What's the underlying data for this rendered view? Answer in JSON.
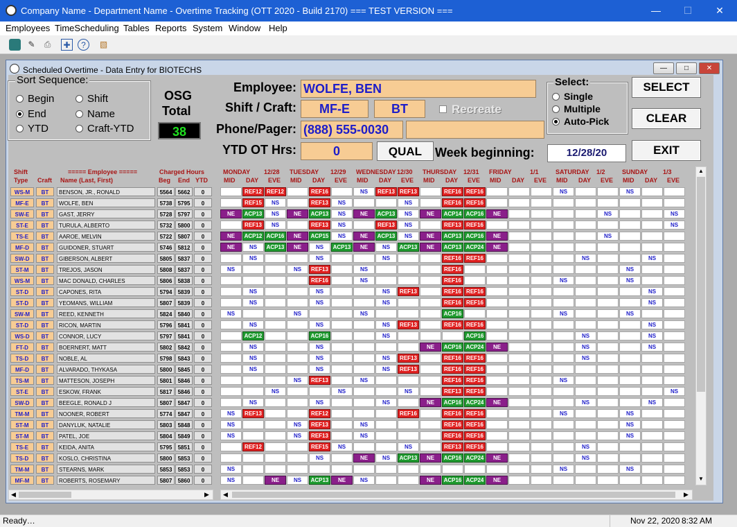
{
  "app": {
    "title": "Company Name - Department Name - Overtime Tracking (OTT 2020 - Build 2170)  === TEST VERSION ==="
  },
  "menu": [
    "Employees",
    "TimeScheduling",
    "Tables",
    "Reports",
    "System",
    "Window",
    "Help"
  ],
  "window": {
    "title": "Scheduled Overtime - Data Entry for BIOTECHS"
  },
  "sort": {
    "legend": "Sort Sequence:",
    "options": [
      "Begin",
      "End",
      "YTD",
      "Shift",
      "Name",
      "Craft-YTD"
    ],
    "selected": "End"
  },
  "osg": {
    "label1": "OSG",
    "label2": "Total",
    "value": "38"
  },
  "employee": {
    "label": "Employee:",
    "value": "WOLFE, BEN"
  },
  "shift": {
    "label": "Shift / Craft:",
    "shift": "MF-E",
    "craft": "BT",
    "recreate": "Recreate"
  },
  "phone": {
    "label": "Phone/Pager:",
    "value": "(888) 555-0030",
    "pager": ""
  },
  "ytd": {
    "label": "YTD OT Hrs:",
    "value": "0",
    "qual": "QUAL"
  },
  "week": {
    "label": "Week beginning:",
    "value": "12/28/20"
  },
  "select": {
    "legend": "Select:",
    "options": [
      "Single",
      "Multiple",
      "Auto-Pick"
    ],
    "selected": "Auto-Pick"
  },
  "buttons": {
    "select": "SELECT",
    "clear": "CLEAR",
    "exit": "EXIT"
  },
  "grid_headers": {
    "shift_type": "Shift\nType",
    "craft": "Craft",
    "employee": "===== Employee =====",
    "name": "Name (Last, First)",
    "charged": "Charged Hours",
    "beg": "Beg",
    "end": "End",
    "ytd": "YTD"
  },
  "days": [
    {
      "name": "MONDAY",
      "date": "12/28"
    },
    {
      "name": "TUESDAY",
      "date": "12/29"
    },
    {
      "name": "WEDNESDAY",
      "date": "12/30"
    },
    {
      "name": "THURSDAY",
      "date": "12/31"
    },
    {
      "name": "FRIDAY",
      "date": "1/1"
    },
    {
      "name": "SATURDAY",
      "date": "1/2"
    },
    {
      "name": "SUNDAY",
      "date": "1/3"
    }
  ],
  "sub": [
    "MID",
    "DAY",
    "EVE"
  ],
  "rows": [
    {
      "t": "WS-M",
      "c": "BT",
      "n": "BENSON, JR., RONALD",
      "b": "5564",
      "e": "5662",
      "y": "0",
      "s": "0 REF12 REF12 0 REF16 0 NS REF13 REF13 0 REF16 REF16 0 0 0 NS 0 0 NS 0 0"
    },
    {
      "t": "MF-E",
      "c": "BT",
      "n": "WOLFE, BEN",
      "b": "5738",
      "e": "5795",
      "y": "0",
      "s": "0 REF15 NS 0 REF13 NS 0 0 NS 0 REF16 REF16 0 0 0 0 0 0 0 0 0"
    },
    {
      "t": "SW-E",
      "c": "BT",
      "n": "GAST, JERRY",
      "b": "5728",
      "e": "5797",
      "y": "0",
      "s": "NE ACP13 NS NE ACP13 NS NE ACP13 NS NE ACP14 ACP16 NE 0 0 0 0 NS 0 0 NS"
    },
    {
      "t": "ST-E",
      "c": "BT",
      "n": "TURULA, ALBERTO",
      "b": "5732",
      "e": "5800",
      "y": "0",
      "s": "0 REF13 NS 0 REF13 NS 0 REF13 NS 0 REF13 REF16 0 0 0 0 0 0 0 0 NS"
    },
    {
      "t": "TS-E",
      "c": "BT",
      "n": "AAROE, MELVIN",
      "b": "5722",
      "e": "5807",
      "y": "0",
      "s": "NE ACP12 ACP16 NE ACP15 NS NE ACP13 NS NE ACP13 ACP16 NE 0 0 0 0 NS 0 0 0"
    },
    {
      "t": "MF-D",
      "c": "BT",
      "n": "GUIDONER, STUART",
      "b": "5746",
      "e": "5812",
      "y": "0",
      "s": "NE NS ACP13 NE NS ACP13 NE NS ACP13 NE ACP13 ACP24 NE 0 0 0 0 0 0 0 0"
    },
    {
      "t": "SW-D",
      "c": "BT",
      "n": "GIBERSON, ALBERT",
      "b": "5805",
      "e": "5837",
      "y": "0",
      "s": "0 NS 0 0 NS 0 0 NS 0 0 REF16 REF16 0 0 0 0 NS 0 0 NS 0"
    },
    {
      "t": "ST-M",
      "c": "BT",
      "n": "TREJOS, JASON",
      "b": "5808",
      "e": "5837",
      "y": "0",
      "s": "NS 0 0 NS REF13 0 NS 0 0 0 REF16 0 0 0 0 0 0 0 NS 0 0"
    },
    {
      "t": "WS-M",
      "c": "BT",
      "n": "MAC DONALD, CHARLES",
      "b": "5806",
      "e": "5838",
      "y": "0",
      "s": "0 0 0 0 REF16 0 NS 0 0 0 REF16 0 0 0 0 NS 0 0 NS 0 0"
    },
    {
      "t": "ST-D",
      "c": "BT",
      "n": "CAPONES, RITA",
      "b": "5794",
      "e": "5839",
      "y": "0",
      "s": "0 NS 0 0 NS 0 0 NS REF13 0 REF16 REF16 0 0 0 0 0 0 0 NS 0"
    },
    {
      "t": "ST-D",
      "c": "BT",
      "n": "YEOMANS, WILLIAM",
      "b": "5807",
      "e": "5839",
      "y": "0",
      "s": "0 NS 0 0 NS 0 0 NS 0 0 REF16 REF16 0 0 0 0 0 0 0 NS 0"
    },
    {
      "t": "SW-M",
      "c": "BT",
      "n": "REED, KENNETH",
      "b": "5824",
      "e": "5840",
      "y": "0",
      "s": "NS 0 0 NS 0 0 NS 0 0 0 ACP16 0 0 0 0 NS 0 0 NS 0 0"
    },
    {
      "t": "ST-D",
      "c": "BT",
      "n": "RICON, MARTIN",
      "b": "5796",
      "e": "5841",
      "y": "0",
      "s": "0 NS 0 0 NS 0 0 NS REF13 0 REF16 REF16 0 0 0 0 0 0 0 NS 0"
    },
    {
      "t": "WS-D",
      "c": "BT",
      "n": "CONNOR, LUCY",
      "b": "5797",
      "e": "5841",
      "y": "0",
      "s": "0 ACP12 0 0 ACP16 0 0 NS 0 0 0 ACP16 0 0 0 0 NS 0 0 NS 0"
    },
    {
      "t": "FT-D",
      "c": "BT",
      "n": "BOERNERT, MATT",
      "b": "5802",
      "e": "5842",
      "y": "0",
      "s": "0 NS 0 0 NS 0 0 0 0 NE ACP16 ACP24 NE 0 0 0 NS 0 0 NS 0"
    },
    {
      "t": "TS-D",
      "c": "BT",
      "n": "NOBLE, AL",
      "b": "5798",
      "e": "5843",
      "y": "0",
      "s": "0 NS 0 0 NS 0 0 NS REF13 0 REF16 REF16 0 0 0 0 NS 0 0 0 0"
    },
    {
      "t": "MF-D",
      "c": "BT",
      "n": "ALVARADO, THYKASA",
      "b": "5800",
      "e": "5845",
      "y": "0",
      "s": "0 NS 0 0 NS 0 0 NS REF13 0 REF16 REF16 0 0 0 0 0 0 0 0 0"
    },
    {
      "t": "TS-M",
      "c": "BT",
      "n": "MATTESON, JOSEPH",
      "b": "5801",
      "e": "5846",
      "y": "0",
      "s": "0 0 0 NS REF13 0 NS 0 0 0 REF16 REF16 0 0 0 NS 0 0 0 0 0"
    },
    {
      "t": "ST-E",
      "c": "BT",
      "n": "ESKOW, FRANK",
      "b": "5817",
      "e": "5846",
      "y": "0",
      "s": "0 0 NS 0 0 NS 0 0 NS 0 REF13 REF16 0 0 0 0 0 0 0 0 NS"
    },
    {
      "t": "SW-D",
      "c": "BT",
      "n": "BEEGLE, RONALD J",
      "b": "5807",
      "e": "5847",
      "y": "0",
      "s": "0 NS 0 0 NS 0 0 NS 0 NE ACP16 ACP24 NE 0 0 0 NS 0 0 NS 0"
    },
    {
      "t": "TM-M",
      "c": "BT",
      "n": "NOONER, ROBERT",
      "b": "5774",
      "e": "5847",
      "y": "0",
      "s": "NS REF13 0 0 REF12 0 0 0 REF16 0 REF16 REF16 0 0 0 NS 0 0 NS 0 0"
    },
    {
      "t": "ST-M",
      "c": "BT",
      "n": "DANYLUK, NATALIE",
      "b": "5803",
      "e": "5848",
      "y": "0",
      "s": "NS 0 0 NS REF13 0 NS 0 0 0 REF16 REF16 0 0 0 0 0 0 NS 0 0"
    },
    {
      "t": "ST-M",
      "c": "BT",
      "n": "PATEL, JOE",
      "b": "5804",
      "e": "5849",
      "y": "0",
      "s": "NS 0 0 NS REF13 0 NS 0 0 0 REF16 REF16 0 0 0 0 0 0 NS 0 0"
    },
    {
      "t": "TS-E",
      "c": "BT",
      "n": "KEIDA, ANITA",
      "b": "5795",
      "e": "5851",
      "y": "0",
      "s": "0 REF12 0 0 REF15 NS 0 0 NS 0 REF13 REF16 0 0 0 0 NS 0 0 0 0"
    },
    {
      "t": "TS-D",
      "c": "BT",
      "n": "KOSLO, CHRISTINA",
      "b": "5800",
      "e": "5853",
      "y": "0",
      "s": "0 0 0 0 NS 0 NE NS ACP13 NE ACP16 ACP24 NE 0 0 0 NS 0 0 0 0"
    },
    {
      "t": "TM-M",
      "c": "BT",
      "n": "STEARNS, MARK",
      "b": "5853",
      "e": "5853",
      "y": "0",
      "s": "NS 0 0 0 0 0 0 0 0 0 0 0 0 0 0 NS 0 0 NS 0 0"
    },
    {
      "t": "MF-M",
      "c": "BT",
      "n": "ROBERTS, ROSEMARY",
      "b": "5807",
      "e": "5860",
      "y": "0",
      "s": "NS 0 NE NS ACP13 NE NS 0 0 NE ACP16 ACP24 NE 0 0 0 0 0 0 0 0"
    }
  ],
  "status": {
    "left": "Ready…",
    "date": "Nov 22, 2020",
    "time": "8:32 AM"
  }
}
